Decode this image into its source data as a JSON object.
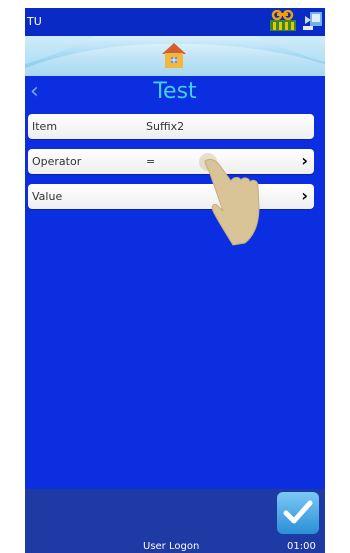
{
  "status": {
    "device_name": "TU",
    "tray_icons": [
      "printer-status-icon",
      "network-status-icon"
    ]
  },
  "header": {
    "home_icon": "home-icon",
    "back_icon": "chevron-left-icon",
    "title": "Test"
  },
  "fields": [
    {
      "label": "Item",
      "value": "Suffix2",
      "has_arrow": false
    },
    {
      "label": "Operator",
      "value": "=",
      "has_arrow": true
    },
    {
      "label": "Value",
      "value": "",
      "has_arrow": true
    }
  ],
  "footer": {
    "confirm_icon": "checkmark-icon",
    "user_logon": "User Logon",
    "time": "01:00"
  },
  "colors": {
    "screen_bg": "#0b2fe0",
    "title": "#3fd0f0",
    "footer_bg": "#1e3ba5"
  }
}
